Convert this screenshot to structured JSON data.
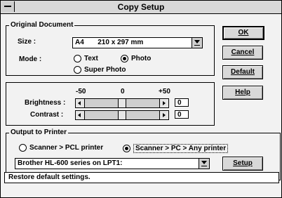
{
  "window": {
    "title": "Copy Setup"
  },
  "original_document": {
    "title": "Original Document",
    "size_label": "Size :",
    "size_value": "A4       210 x 297 mm",
    "mode_label": "Mode :",
    "modes": {
      "text": {
        "label": "Text",
        "selected": false
      },
      "photo": {
        "label": "Photo",
        "selected": true
      },
      "super_photo": {
        "label": "Super Photo",
        "selected": false
      }
    }
  },
  "adjust": {
    "scale_min": "-50",
    "scale_mid": "0",
    "scale_max": "+50",
    "brightness_label": "Brightness :",
    "brightness_value": "0",
    "contrast_label": "Contrast :",
    "contrast_value": "0"
  },
  "output": {
    "title": "Output to Printer",
    "options": {
      "pcl": {
        "label": "Scanner > PCL printer",
        "selected": false
      },
      "any": {
        "label": "Scanner > PC > Any printer",
        "selected": true
      }
    },
    "printer_value": "Brother HL-600 series on LPT1:",
    "setup_label": "Setup"
  },
  "buttons": {
    "ok": "OK",
    "cancel": "Cancel",
    "default": "Default",
    "help": "Help"
  },
  "status": {
    "text": "Restore default settings."
  }
}
